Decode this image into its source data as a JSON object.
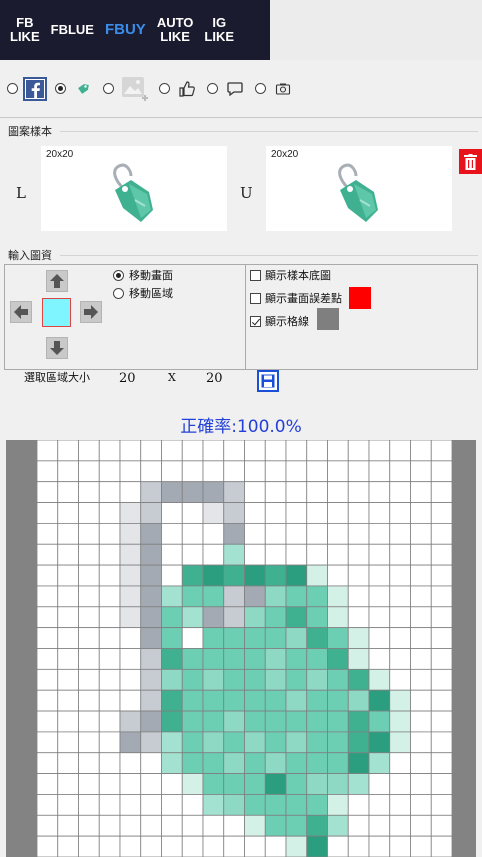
{
  "nav": {
    "items": [
      {
        "line1": "FB",
        "line2": "LIKE",
        "active": false
      },
      {
        "line1": "FBLUE",
        "line2": "",
        "active": false
      },
      {
        "line1": "FBUY",
        "line2": "",
        "active": true
      },
      {
        "line1": "AUTO",
        "line2": "LIKE",
        "active": false
      },
      {
        "line1": "IG",
        "line2": "LIKE",
        "active": false
      }
    ]
  },
  "tools": [
    {
      "icon": "facebook-icon",
      "selected": false
    },
    {
      "icon": "price-tag-icon",
      "selected": true
    },
    {
      "icon": "add-image-icon",
      "selected": false
    },
    {
      "icon": "thumbs-up-icon",
      "selected": false
    },
    {
      "icon": "comment-icon",
      "selected": false
    },
    {
      "icon": "camera-icon",
      "selected": false
    }
  ],
  "sample_section": {
    "label": "圖案樣本",
    "left_label": "L",
    "right_label": "U",
    "left_size": "20x20",
    "right_size": "20x20"
  },
  "input_section": {
    "label": "輸入圖資",
    "move_canvas": "移動畫面",
    "move_region": "移動區域",
    "show_sample_bg": "顯示樣本底圖",
    "show_canvas_diff": "顯示畫面誤差點",
    "show_grid": "顯示格線",
    "diff_color": "#ff0000",
    "grid_color": "#7f7f7f",
    "show_sample_bg_checked": false,
    "show_canvas_diff_checked": false,
    "show_grid_checked": true,
    "move_canvas_selected": true
  },
  "size_row": {
    "label": "選取區域大小",
    "width": "20",
    "x": "X",
    "height": "20"
  },
  "accuracy": "正確率:100.0%",
  "pixel_grid": {
    "cols": 20,
    "rows": 20,
    "palette": {
      "0": "#ffffff",
      "1": "#e3e5e8",
      "2": "#a4aab3",
      "3": "#c7ccd2",
      "4": "#3fb191",
      "5": "#6ccfb4",
      "6": "#a3e2d0",
      "7": "#d4f1e8",
      "8": "#8ed9c4",
      "9": "#2c9e80"
    },
    "rows_data": [
      "00000000000000000000",
      "00000000000000000000",
      "00000322230000000000",
      "00001300130000000000",
      "00001200020000000000",
      "00001200060000000000",
      "00001204949497000000",
      "00001265532855700000",
      "00001256238545700000",
      "00000250555584570000",
      "00000345555855470000",
      "00000385855858547000",
      "00000345555585589700",
      "00003245585555545700",
      "00002365858585549700",
      "00000065585855596000",
      "00000007555958860000",
      "00000000685555700000",
      "00000000007554600000",
      "00000000000079000000"
    ]
  }
}
